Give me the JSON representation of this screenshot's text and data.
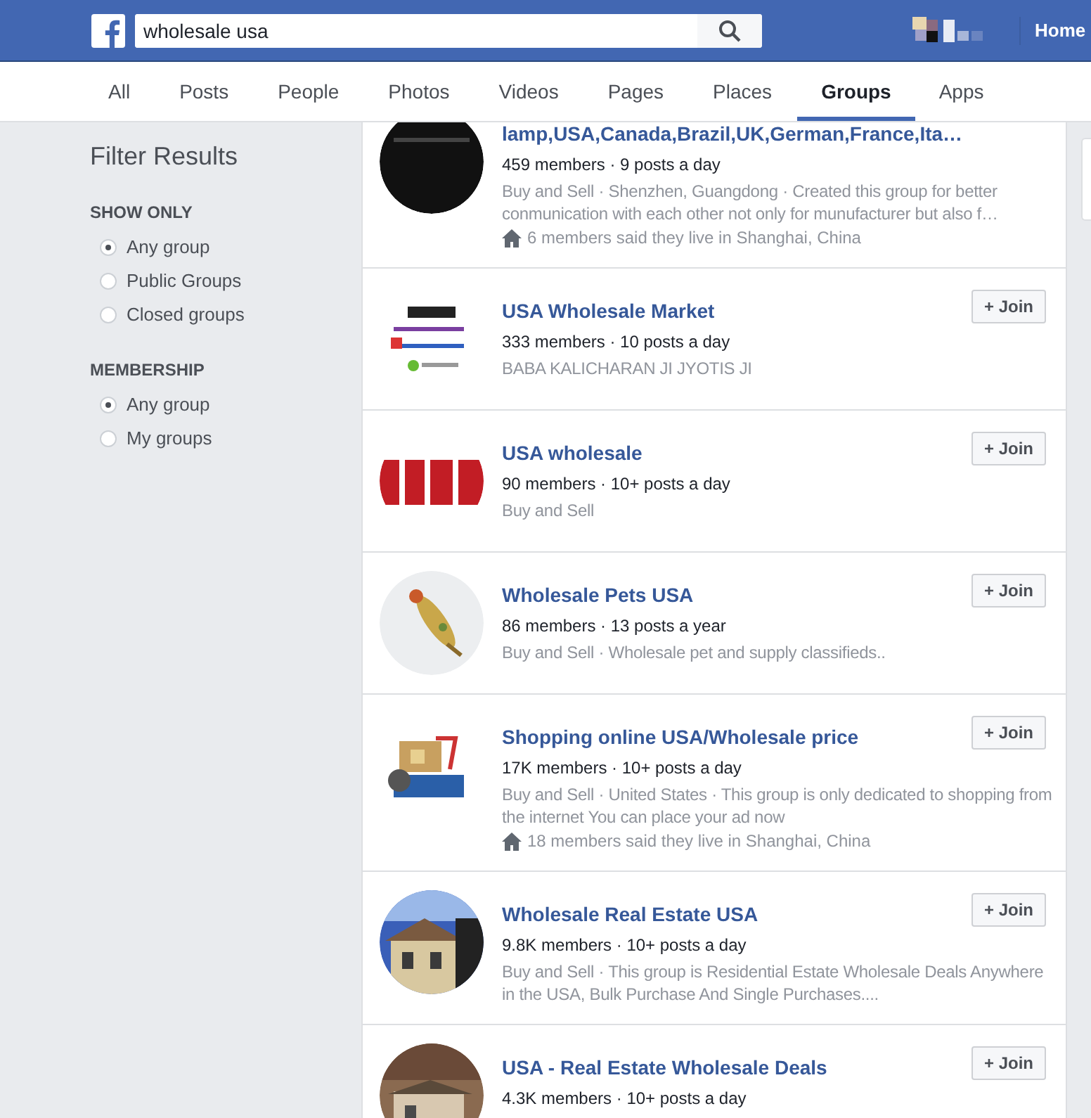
{
  "header": {
    "search": {
      "value": "wholesale usa"
    },
    "nav": [
      {
        "label": "Home"
      }
    ]
  },
  "tabs": [
    {
      "label": "All",
      "selected": false
    },
    {
      "label": "Posts",
      "selected": false
    },
    {
      "label": "People",
      "selected": false
    },
    {
      "label": "Photos",
      "selected": false
    },
    {
      "label": "Videos",
      "selected": false
    },
    {
      "label": "Pages",
      "selected": false
    },
    {
      "label": "Places",
      "selected": false
    },
    {
      "label": "Groups",
      "selected": true
    },
    {
      "label": "Apps",
      "selected": false
    }
  ],
  "sidebar": {
    "title": "Filter Results",
    "sections": [
      {
        "heading": "SHOW ONLY",
        "options": [
          {
            "label": "Any group",
            "selected": true
          },
          {
            "label": "Public Groups",
            "selected": false
          },
          {
            "label": "Closed groups",
            "selected": false
          }
        ]
      },
      {
        "heading": "MEMBERSHIP",
        "options": [
          {
            "label": "Any group",
            "selected": true
          },
          {
            "label": "My groups",
            "selected": false
          }
        ]
      }
    ]
  },
  "results": [
    {
      "name": "lamp,USA,Canada,Brazil,UK,German,France,Ita…",
      "stats": "459 members · 9 posts a day",
      "description": "Buy and Sell · Shenzhen, Guangdong · Created this group for better conmunication with each other not only for munufacturer but also f…",
      "location": "6 members said they live in Shanghai, China",
      "kind": "picture"
    },
    {
      "name": "USA Wholesale Market",
      "stats": "333 members · 10 posts a day",
      "description": "BABA KALICHARAN JI JYOTIS JI",
      "join": "+ Join",
      "kind": "picture"
    },
    {
      "name": "USA wholesale",
      "stats": "90 members · 10+ posts a day",
      "description": "Buy and Sell",
      "join": "+ Join",
      "kind": "picture"
    },
    {
      "name": "Wholesale Pets USA",
      "stats": "86 members · 13 posts a year",
      "description": "Buy and Sell · Wholesale pet and supply classifieds..",
      "join": "+ Join",
      "kind": "picture"
    },
    {
      "name": "Shopping online USA/Wholesale price",
      "stats": "17K members · 10+ posts a day",
      "description": "Buy and Sell · United States · This group is only dedicated to shopping from the internet You can place your ad now",
      "location": "18 members said they live in Shanghai, China",
      "join": "+ Join",
      "kind": "picture"
    },
    {
      "name": "Wholesale Real Estate USA",
      "stats": "9.8K members · 10+ posts a day",
      "description": "Buy and Sell · This group is Residential Estate Wholesale Deals Anywhere in the USA, Bulk Purchase And Single Purchases....",
      "join": "+ Join",
      "kind": "picture"
    },
    {
      "name": "USA - Real Estate Wholesale Deals",
      "stats": "4.3K members · 10+ posts a day",
      "join": "+ Join",
      "kind": "picture"
    }
  ]
}
